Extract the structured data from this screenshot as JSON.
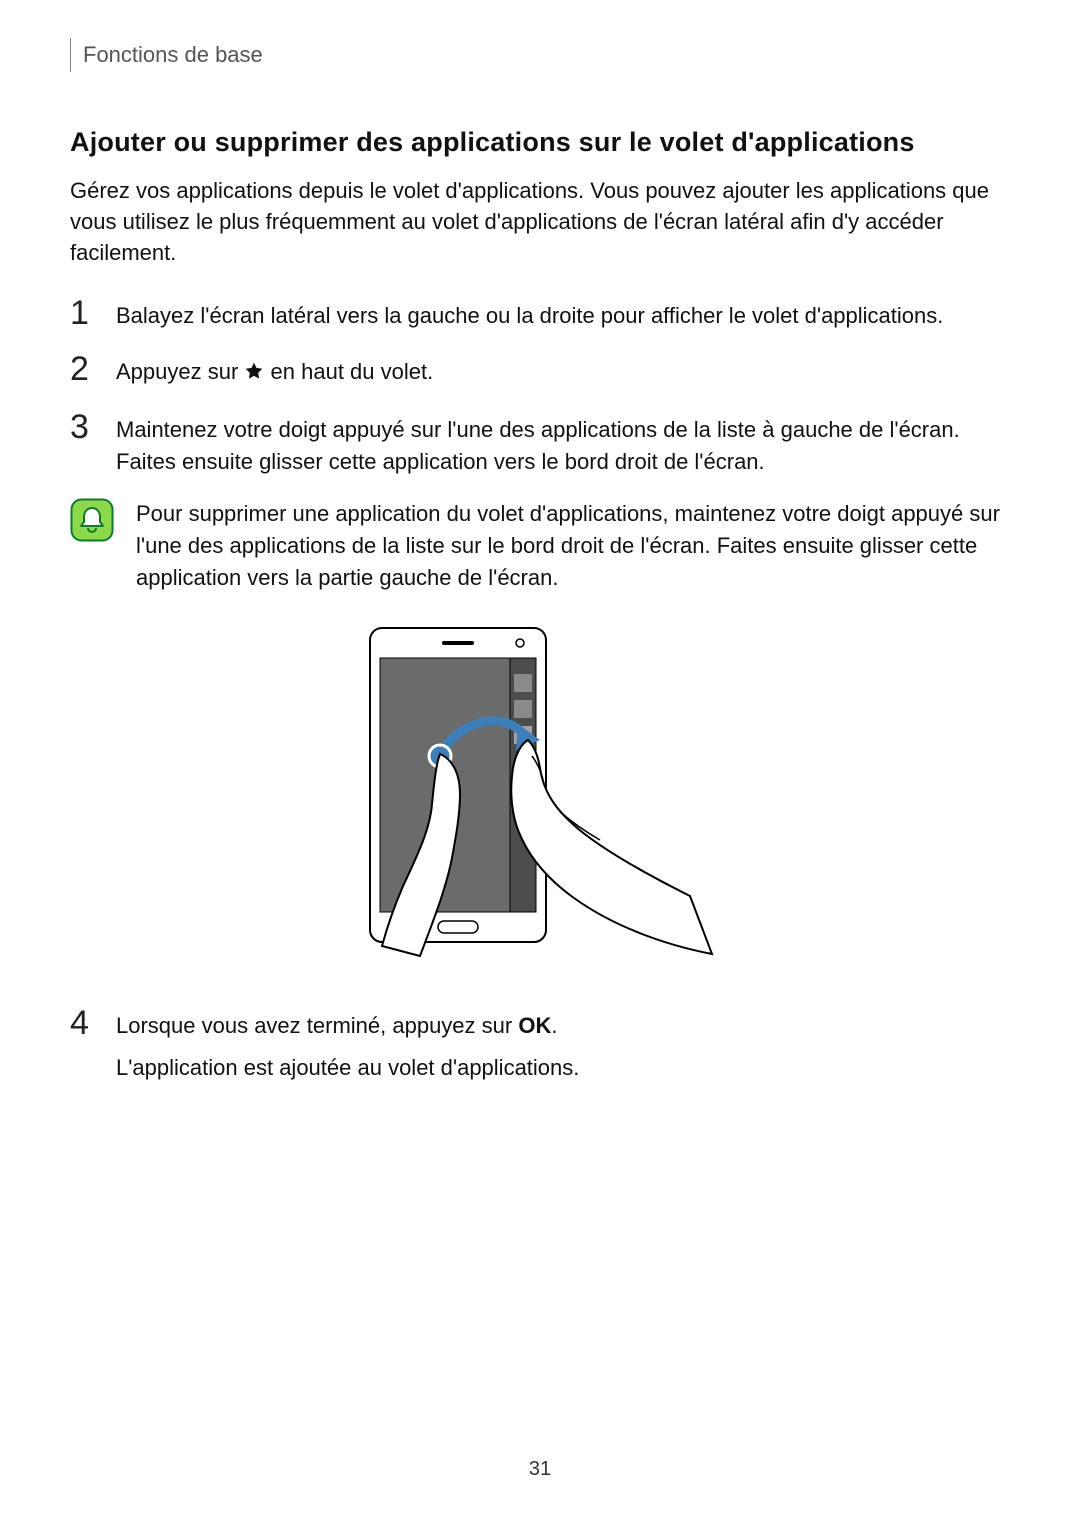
{
  "header": {
    "section": "Fonctions de base"
  },
  "title": "Ajouter ou supprimer des applications sur le volet d'applications",
  "intro": "Gérez vos applications depuis le volet d'applications. Vous pouvez ajouter les applications que vous utilisez le plus fréquemment au volet d'applications de l'écran latéral afin d'y accéder facilement.",
  "steps": {
    "s1": {
      "num": "1",
      "text": "Balayez l'écran latéral vers la gauche ou la droite pour afficher le volet d'applications."
    },
    "s2": {
      "num": "2",
      "text_before": "Appuyez sur ",
      "text_after": " en haut du volet."
    },
    "s3": {
      "num": "3",
      "text": "Maintenez votre doigt appuyé sur l'une des applications de la liste à gauche de l'écran. Faites ensuite glisser cette application vers le bord droit de l'écran."
    },
    "s4": {
      "num": "4",
      "text_before": "Lorsque vous avez terminé, appuyez sur ",
      "bold": "OK",
      "text_after": ".",
      "text_line2": "L'application est ajoutée au volet d'applications."
    }
  },
  "note": "Pour supprimer une application du volet d'applications, maintenez votre doigt appuyé sur l'une des applications de la liste sur le bord droit de l'écran. Faites ensuite glisser cette application vers la partie gauche de l'écran.",
  "page_number": "31"
}
